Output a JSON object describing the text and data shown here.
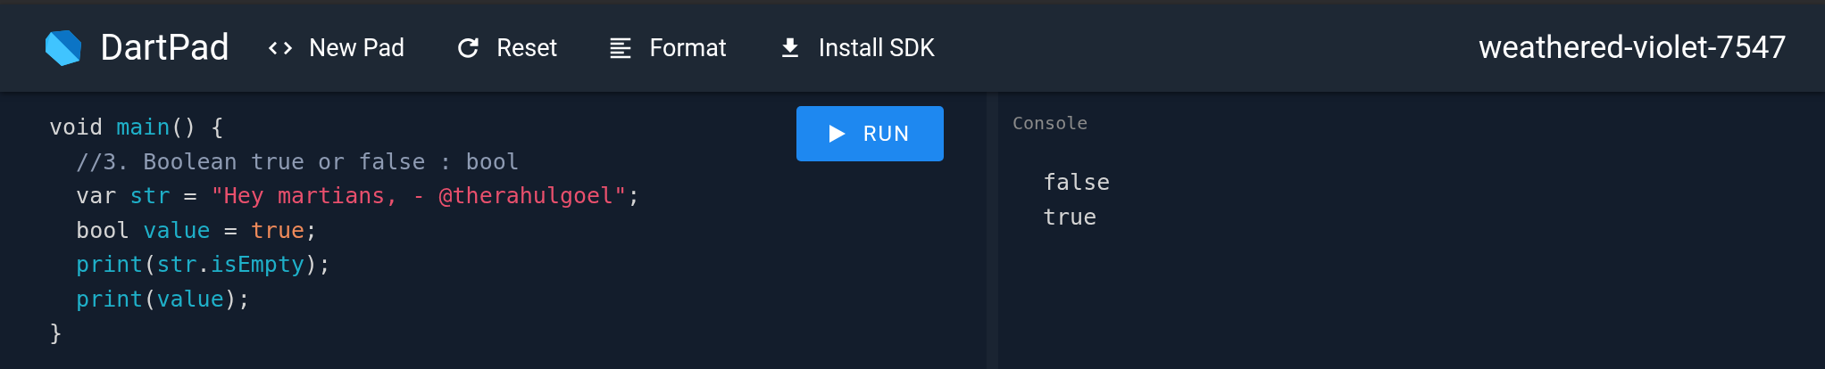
{
  "header": {
    "app_name": "DartPad",
    "actions": [
      {
        "kind": "code",
        "label": "New Pad"
      },
      {
        "kind": "refresh",
        "label": "Reset"
      },
      {
        "kind": "format",
        "label": "Format"
      },
      {
        "kind": "download",
        "label": "Install SDK"
      }
    ],
    "pad_name": "weathered-violet-7547"
  },
  "editor": {
    "run_button": "RUN",
    "lines": [
      [
        {
          "kind": "plain",
          "text": "void "
        },
        {
          "kind": "name",
          "text": "main"
        },
        {
          "kind": "plain",
          "text": "() {"
        }
      ],
      [
        {
          "kind": "comment",
          "text": "  //3. Boolean true or false : bool"
        }
      ],
      [
        {
          "kind": "plain",
          "text": "  var "
        },
        {
          "kind": "name",
          "text": "str"
        },
        {
          "kind": "plain",
          "text": " = "
        },
        {
          "kind": "string",
          "text": "\"Hey martians, - @therahulgoel\""
        },
        {
          "kind": "plain",
          "text": ";"
        }
      ],
      [
        {
          "kind": "plain",
          "text": "  bool "
        },
        {
          "kind": "name",
          "text": "value"
        },
        {
          "kind": "plain",
          "text": " = "
        },
        {
          "kind": "literal",
          "text": "true"
        },
        {
          "kind": "plain",
          "text": ";"
        }
      ],
      [
        {
          "kind": "name",
          "text": "  print"
        },
        {
          "kind": "plain",
          "text": "("
        },
        {
          "kind": "name",
          "text": "str"
        },
        {
          "kind": "plain",
          "text": "."
        },
        {
          "kind": "name",
          "text": "isEmpty"
        },
        {
          "kind": "plain",
          "text": ");"
        }
      ],
      [
        {
          "kind": "name",
          "text": "  print"
        },
        {
          "kind": "plain",
          "text": "("
        },
        {
          "kind": "name",
          "text": "value"
        },
        {
          "kind": "plain",
          "text": ");"
        }
      ],
      [
        {
          "kind": "plain",
          "text": "}"
        }
      ]
    ]
  },
  "console": {
    "title": "Console",
    "output": [
      "false",
      "true"
    ]
  }
}
